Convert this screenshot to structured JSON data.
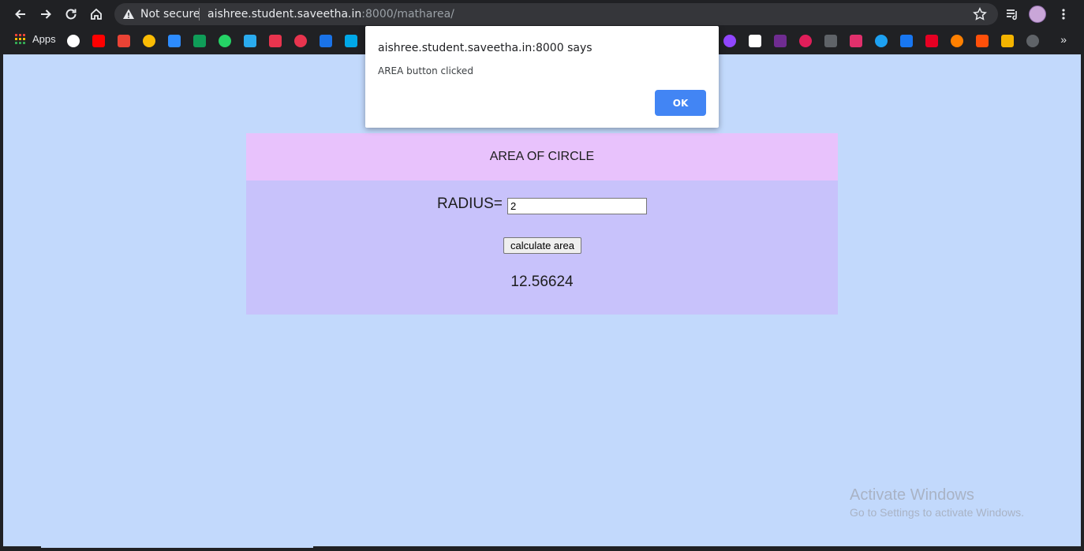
{
  "browser": {
    "security_label": "Not secure",
    "url_host": "aishree.student.saveetha.in",
    "url_path": ":8000/matharea/",
    "bookmarks": {
      "apps_label": "Apps",
      "overflow_label": "»",
      "icons": [
        {
          "name": "google-icon",
          "color": "#ffffff"
        },
        {
          "name": "youtube-icon",
          "color": "#ff0000"
        },
        {
          "name": "gmail-icon",
          "color": "#ea4335"
        },
        {
          "name": "google-drive-icon",
          "color": "#fbbc04"
        },
        {
          "name": "zoom-icon",
          "color": "#2d8cff"
        },
        {
          "name": "hangouts-icon",
          "color": "#0f9d58"
        },
        {
          "name": "whatsapp-icon",
          "color": "#25d366"
        },
        {
          "name": "telegram-icon",
          "color": "#2aabee"
        },
        {
          "name": "m-logo-icon",
          "color": "#e8344e"
        },
        {
          "name": "u-logo-icon",
          "color": "#e8344e"
        },
        {
          "name": "g-logo-icon",
          "color": "#1a73e8"
        },
        {
          "name": "w-logo-icon",
          "color": "#00a8e8"
        },
        {
          "name": "twitch-icon",
          "color": "#9146ff"
        },
        {
          "name": "calendar-icon",
          "color": "#ffffff"
        },
        {
          "name": "p-logo-icon",
          "color": "#6f2c91"
        },
        {
          "name": "slack-icon",
          "color": "#e01e5a"
        },
        {
          "name": "grid-icon",
          "color": "#5f6368"
        },
        {
          "name": "instagram-icon",
          "color": "#e1306c"
        },
        {
          "name": "twitter-icon",
          "color": "#1da1f2"
        },
        {
          "name": "facebook-icon",
          "color": "#1877f2"
        },
        {
          "name": "pinterest-icon",
          "color": "#e60023"
        },
        {
          "name": "blogger-icon",
          "color": "#ff8000"
        },
        {
          "name": "wattpad-icon",
          "color": "#ff500a"
        },
        {
          "name": "b-logo-icon",
          "color": "#f4b400"
        },
        {
          "name": "github-icon",
          "color": "#5f6368"
        }
      ]
    }
  },
  "page": {
    "title": "AREA OF CIRCLE",
    "radius_label": "RADIUS=",
    "radius_value": "2",
    "button_label": "calculate area",
    "result": "12.56624"
  },
  "dialog": {
    "title": "aishree.student.saveetha.in:8000 says",
    "message": "AREA button clicked",
    "ok_label": "OK"
  },
  "watermark": {
    "title": "Activate Windows",
    "subtitle": "Go to Settings to activate Windows."
  },
  "colors": {
    "page_background": "#c2d9fc",
    "card_header": "#e8c2fc",
    "card_body": "#c8c2fb",
    "dialog_button": "#4285f4"
  }
}
